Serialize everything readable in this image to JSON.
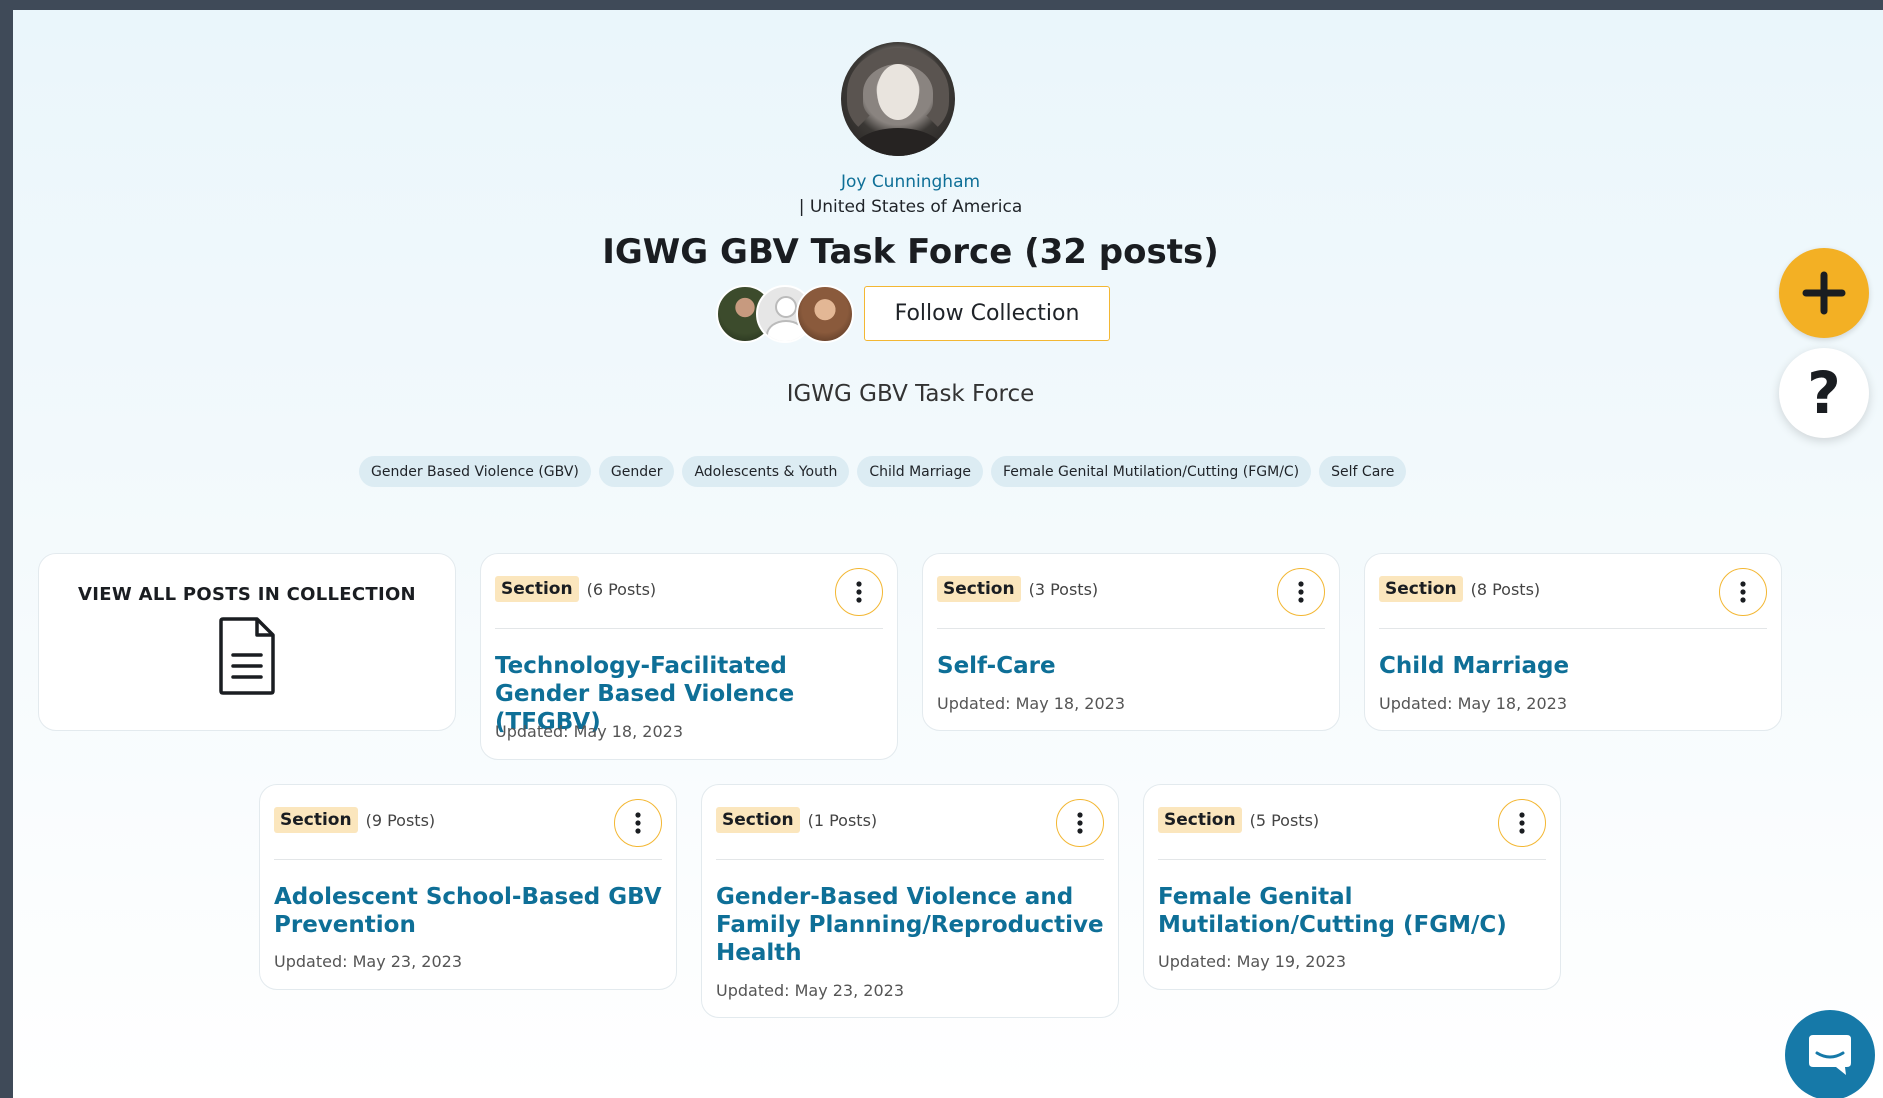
{
  "profile": {
    "name": "Joy Cunningham",
    "country": "| United States of America"
  },
  "collection": {
    "title": "IGWG GBV Task Force (32 posts)",
    "subtitle": "IGWG GBV Task Force",
    "follow_label": "Follow Collection"
  },
  "tags": [
    "Gender Based Violence (GBV)",
    "Gender",
    "Adolescents & Youth",
    "Child Marriage",
    "Female Genital Mutilation/Cutting (FGM/C)",
    "Self Care"
  ],
  "view_all": {
    "label": "VIEW ALL POSTS IN COLLECTION",
    "icon": "document-icon"
  },
  "sections": [
    {
      "badge": "Section",
      "count": "(6 Posts)",
      "title": "Technology-Facilitated Gender Based Violence (TFGBV)",
      "updated": "Updated: May 18, 2023"
    },
    {
      "badge": "Section",
      "count": "(3 Posts)",
      "title": "Self-Care",
      "updated": "Updated: May 18, 2023"
    },
    {
      "badge": "Section",
      "count": "(8 Posts)",
      "title": "Child Marriage",
      "updated": "Updated: May 18, 2023"
    },
    {
      "badge": "Section",
      "count": "(9 Posts)",
      "title": "Adolescent School-Based GBV Prevention",
      "updated": "Updated: May 23, 2023"
    },
    {
      "badge": "Section",
      "count": "(1 Posts)",
      "title": "Gender-Based Violence and Family Planning/Reproductive Health",
      "updated": "Updated: May 23, 2023"
    },
    {
      "badge": "Section",
      "count": "(5 Posts)",
      "title": "Female Genital Mutilation/Cutting (FGM/C)",
      "updated": "Updated: May 19, 2023"
    }
  ],
  "fab": {
    "add_icon": "plus-icon",
    "help_label": "?",
    "chat_icon": "chat-icon"
  },
  "colors": {
    "accent": "#f3b024",
    "link": "#0e6f97",
    "badge_bg": "#fbe6bd",
    "tag_bg": "#dcecf3",
    "chat": "#1679a8"
  }
}
